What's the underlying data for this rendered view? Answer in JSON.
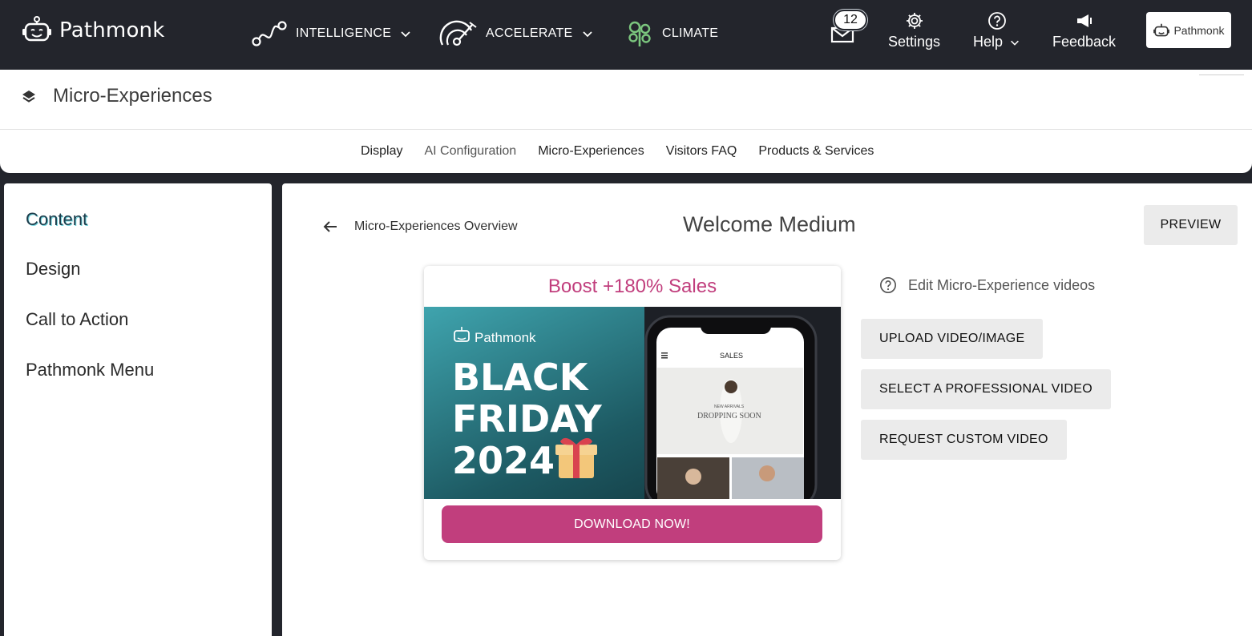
{
  "app": {
    "brand": "Pathmonk",
    "account_label": "Pathmonk"
  },
  "nav": {
    "items": [
      {
        "label": "INTELLIGENCE",
        "icon": "route-icon",
        "has_dropdown": true
      },
      {
        "label": "ACCELERATE",
        "icon": "gauge-icon",
        "has_dropdown": true
      },
      {
        "label": "CLIMATE",
        "icon": "tree-icon",
        "has_dropdown": false
      }
    ],
    "mail_count": "12",
    "settings_label": "Settings",
    "help_label": "Help",
    "feedback_label": "Feedback"
  },
  "page": {
    "title": "Micro-Experiences"
  },
  "tabs": [
    "Display",
    "AI Configuration",
    "Micro-Experiences",
    "Visitors FAQ",
    "Products & Services"
  ],
  "sidebar": {
    "items": [
      "Content",
      "Design",
      "Call to Action",
      "Pathmonk Menu"
    ],
    "active": "Content"
  },
  "main": {
    "back_label": "Micro-Experiences Overview",
    "title": "Welcome Medium",
    "preview_label": "PREVIEW",
    "card": {
      "headline": "Boost +180% Sales",
      "media": {
        "brand": "Pathmonk",
        "line1": "BLACK",
        "line2": "FRIDAY",
        "line3": "2024",
        "phone_header": "SALES",
        "phone_banner_small": "NEW ARRIVALS",
        "phone_banner": "DROPPING SOON"
      },
      "cta_label": "DOWNLOAD NOW!"
    },
    "help_text": "Edit Micro-Experience videos",
    "buttons": {
      "upload": "UPLOAD VIDEO/IMAGE",
      "select": "SELECT A PROFESSIONAL VIDEO",
      "request": "REQUEST CUSTOM VIDEO"
    }
  },
  "colors": {
    "nav_bg": "#23252c",
    "accent_pink": "#c13e7d",
    "button_gray": "#ebebeb",
    "climate_green": "#7bc67e"
  }
}
